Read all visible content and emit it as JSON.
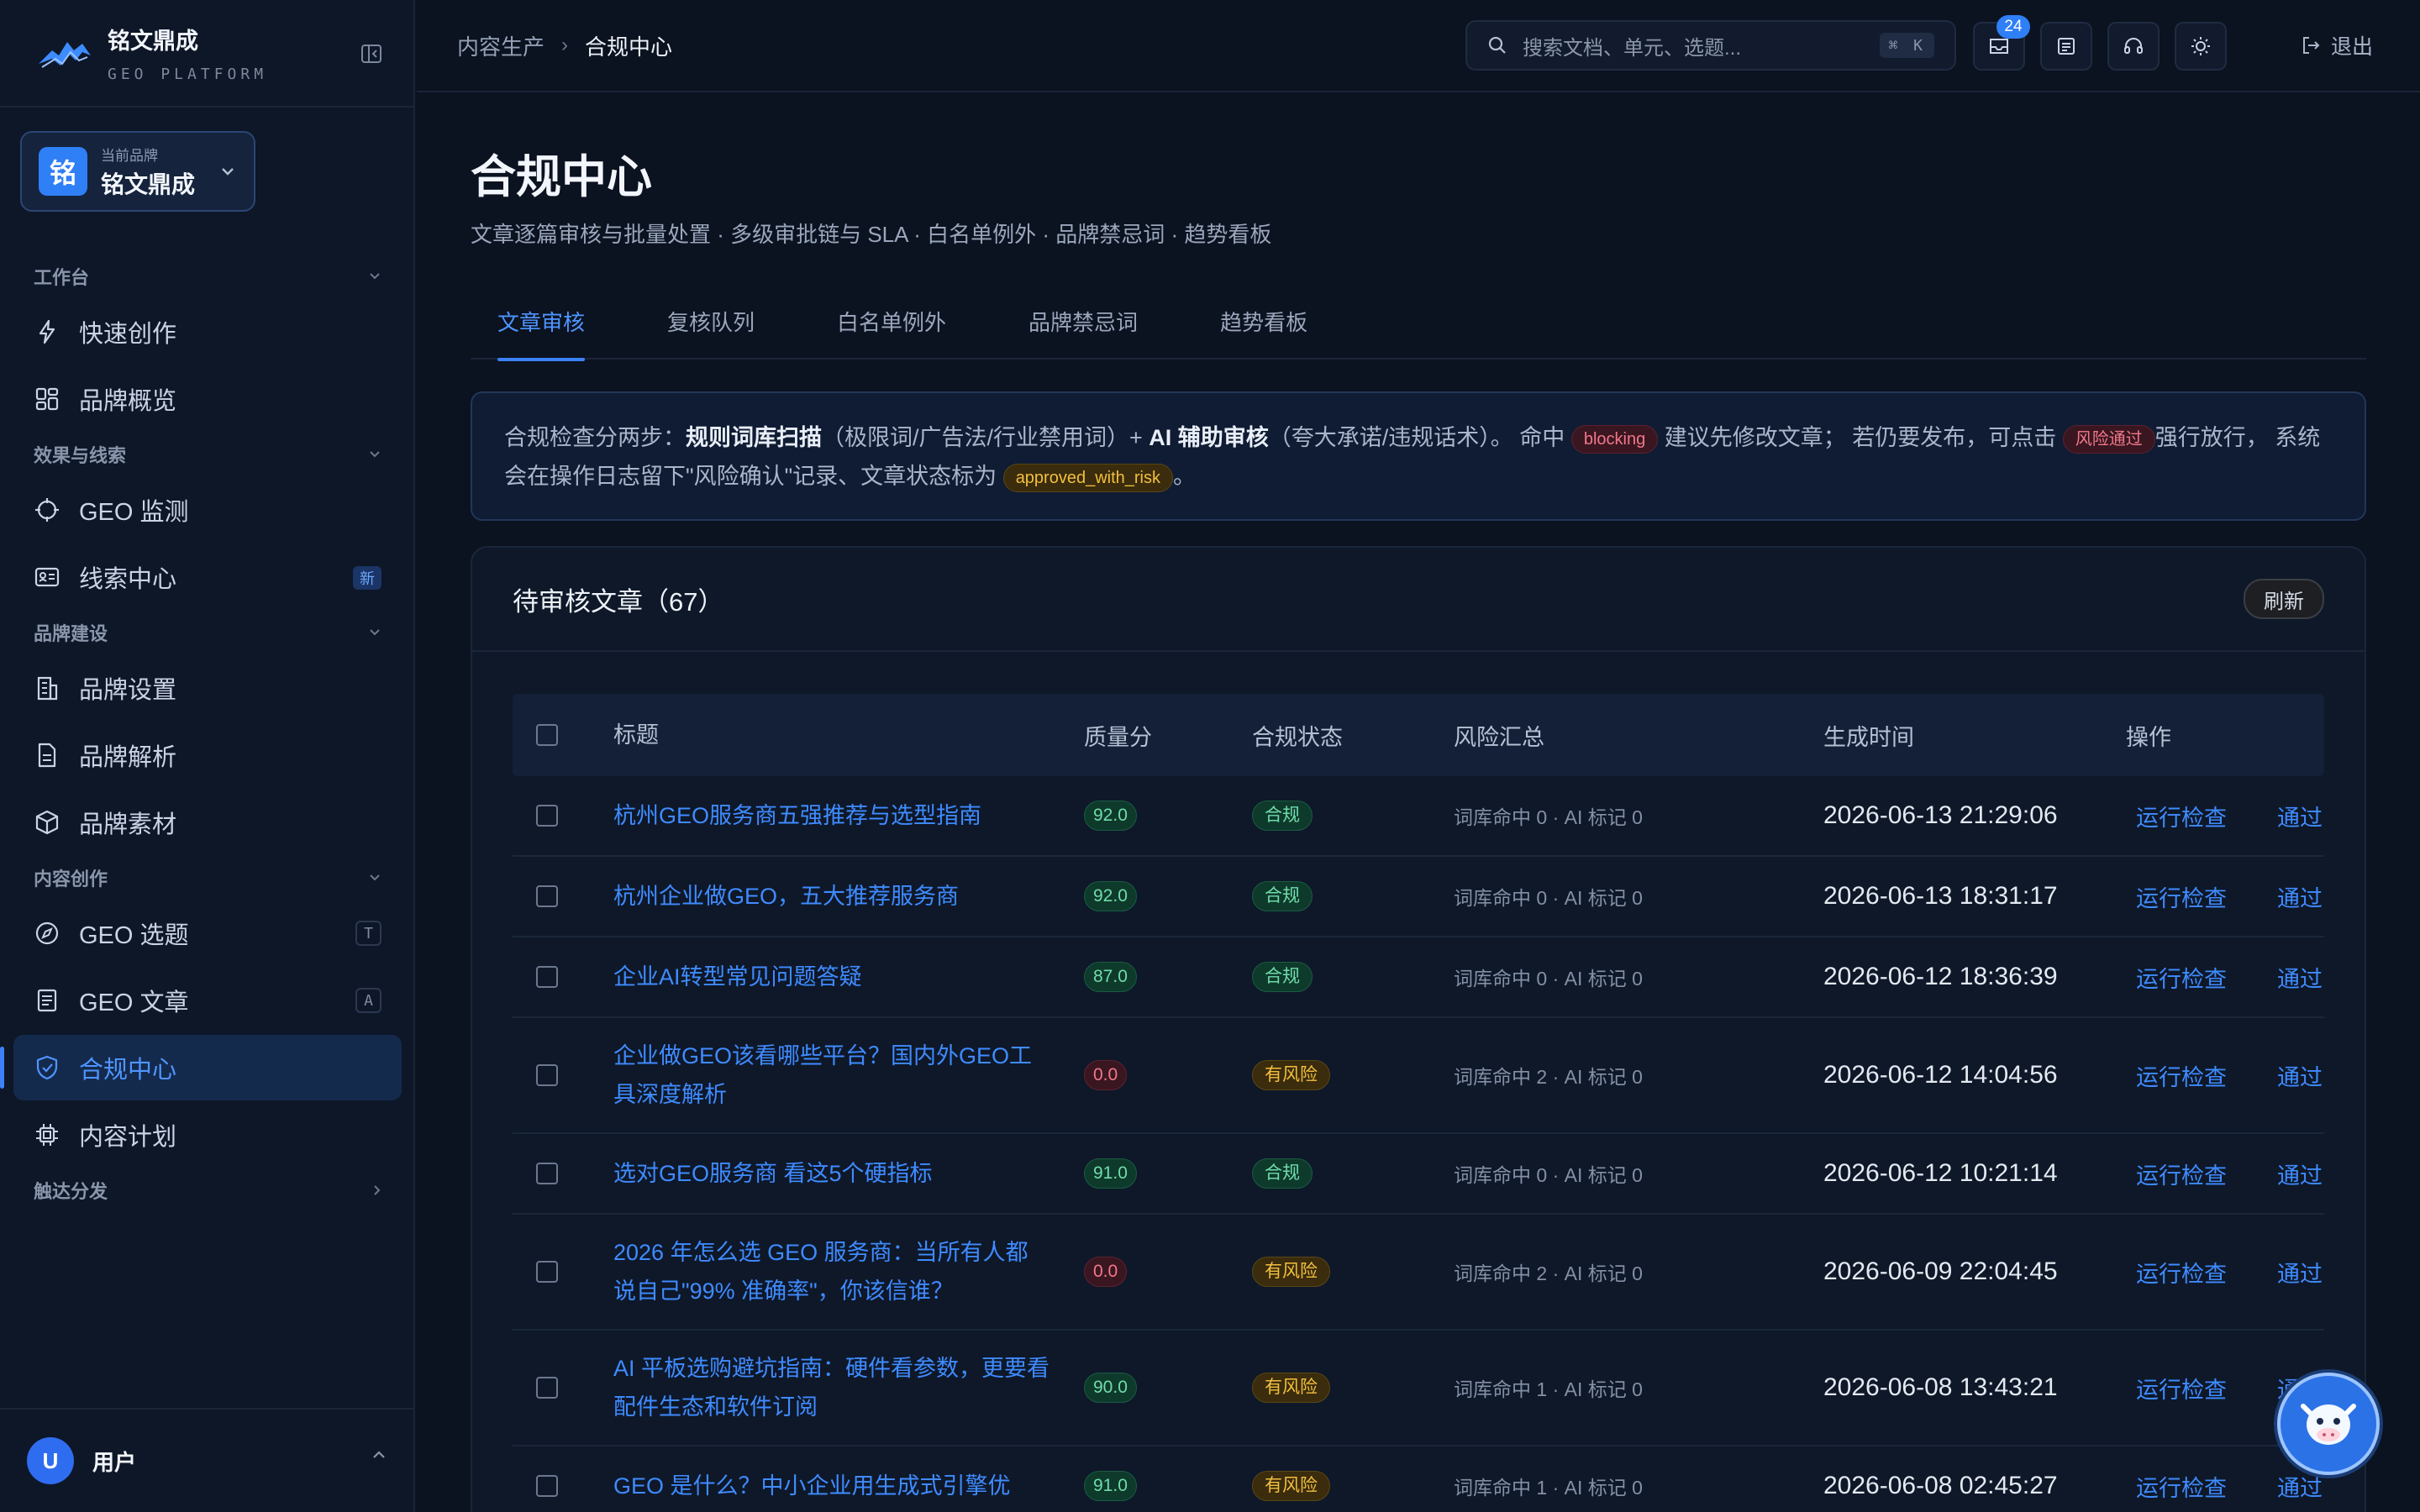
{
  "app": {
    "brand_name": "铭文鼎成",
    "brand_sub": "GEO PLATFORM",
    "current_brand_label": "当前品牌",
    "current_brand_value": "铭文鼎成",
    "current_brand_initial": "铭"
  },
  "sidebar": {
    "groups": {
      "workbench": "工作台",
      "effect": "效果与线索",
      "brand": "品牌建设",
      "content": "内容创作",
      "distribution": "触达分发"
    },
    "items": {
      "quick_create": "快速创作",
      "brand_overview": "品牌概览",
      "geo_monitor": "GEO 监测",
      "leads": "线索中心",
      "leads_badge": "新",
      "brand_settings": "品牌设置",
      "brand_analysis": "品牌解析",
      "brand_assets": "品牌素材",
      "geo_topics": "GEO 选题",
      "geo_topics_key": "T",
      "geo_articles": "GEO 文章",
      "geo_articles_key": "A",
      "compliance": "合规中心",
      "content_plan": "内容计划"
    },
    "user": {
      "initial": "U",
      "name": "用户"
    }
  },
  "topbar": {
    "breadcrumb": [
      "内容生产",
      "合规中心"
    ],
    "search_placeholder": "搜索文档、单元、选题...",
    "search_shortcut": "⌘ K",
    "mail_count": "24",
    "logout": "退出"
  },
  "page": {
    "title": "合规中心",
    "subtitle": "文章逐篇审核与批量处置 · 多级审批链与 SLA · 白名单例外 · 品牌禁忌词 · 趋势看板",
    "tabs": [
      "文章审核",
      "复核队列",
      "白名单例外",
      "品牌禁忌词",
      "趋势看板"
    ],
    "notice": {
      "p1": "合规检查分两步：",
      "b1": "规则词库扫描",
      "p2": "（极限词/广告法/行业禁用词）+ ",
      "b2": "AI 辅助审核",
      "p3": "（夸大承诺/违规话术）。 命中",
      "pill1": "blocking",
      "p4": "建议先修改文章； 若仍要发布，可点击",
      "pill2": "风险通过",
      "p5": "强行放行， 系统会在操作日志留下\"风险确认\"记录、文章状态标为",
      "pill3": "approved_with_risk",
      "p6": "。"
    },
    "card_title": "待审核文章（67）",
    "refresh": "刷新",
    "columns": {
      "title": "标题",
      "score": "质量分",
      "status": "合规状态",
      "risk": "风险汇总",
      "time": "生成时间",
      "ops": "操作"
    },
    "op_check": "运行检查",
    "op_pass": "通过",
    "rows": [
      {
        "title": "杭州GEO服务商五强推荐与选型指南",
        "score": "92.0",
        "status": "合规",
        "risk": "词库命中 0 · AI 标记 0",
        "time": "2026-06-13 21:29:06"
      },
      {
        "title": "杭州企业做GEO，五大推荐服务商",
        "score": "92.0",
        "status": "合规",
        "risk": "词库命中 0 · AI 标记 0",
        "time": "2026-06-13 18:31:17"
      },
      {
        "title": "企业AI转型常见问题答疑",
        "score": "87.0",
        "status": "合规",
        "risk": "词库命中 0 · AI 标记 0",
        "time": "2026-06-12 18:36:39"
      },
      {
        "title": "企业做GEO该看哪些平台？国内外GEO工具深度解析",
        "score": "0.0",
        "status": "有风险",
        "risk": "词库命中 2 · AI 标记 0",
        "time": "2026-06-12 14:04:56"
      },
      {
        "title": "选对GEO服务商 看这5个硬指标",
        "score": "91.0",
        "status": "合规",
        "risk": "词库命中 0 · AI 标记 0",
        "time": "2026-06-12 10:21:14"
      },
      {
        "title": "2026 年怎么选 GEO 服务商：当所有人都说自己\"99% 准确率\"，你该信谁？",
        "score": "0.0",
        "status": "有风险",
        "risk": "词库命中 2 · AI 标记 0",
        "time": "2026-06-09 22:04:45"
      },
      {
        "title": "AI 平板选购避坑指南：硬件看参数，更要看配件生态和软件订阅",
        "score": "90.0",
        "status": "有风险",
        "risk": "词库命中 1 · AI 标记 0",
        "time": "2026-06-08 13:43:21"
      },
      {
        "title": "GEO 是什么？中小企业用生成式引擎优",
        "score": "91.0",
        "status": "有风险",
        "risk": "词库命中 1 · AI 标记 0",
        "time": "2026-06-08 02:45:27"
      }
    ]
  },
  "colors": {
    "accent": "#3b82f6",
    "ok": "#6fdcab",
    "risk": "#f4bf3f",
    "danger": "#f0788a"
  }
}
